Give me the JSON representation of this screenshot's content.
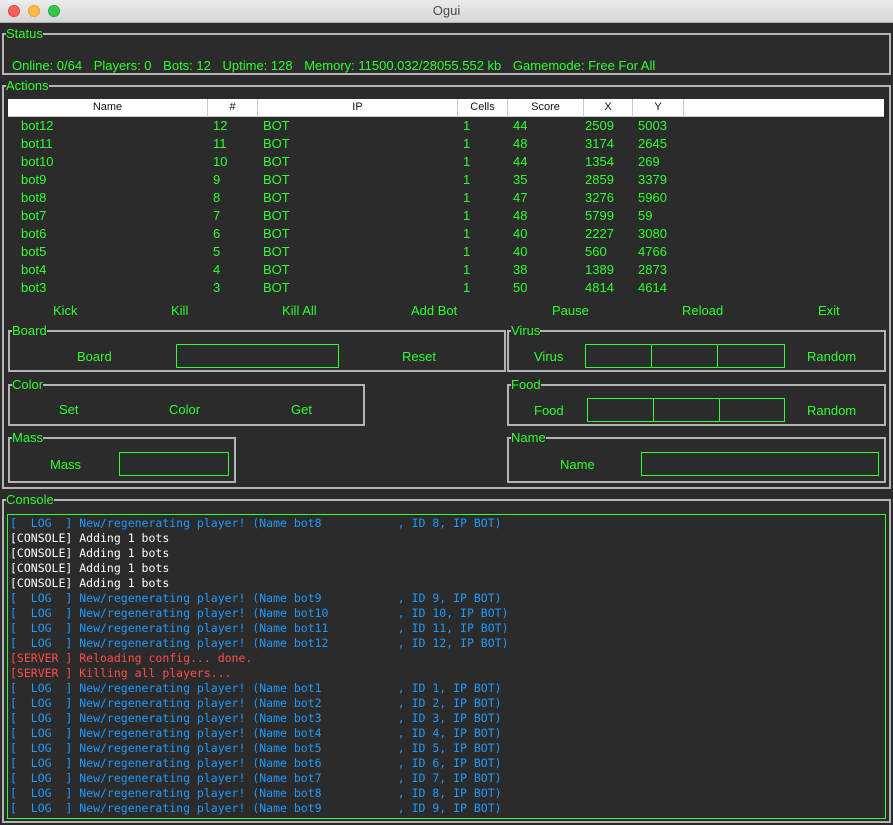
{
  "window": {
    "title": "Ogui"
  },
  "status": {
    "legend": "Status",
    "online": "Online: 0/64",
    "players": "Players: 0",
    "bots": "Bots: 12",
    "uptime": "Uptime: 128",
    "memory": "Memory: 11500.032/28055.552 kb",
    "gamemode": "Gamemode: Free For All"
  },
  "actions": {
    "legend": "Actions",
    "columns": [
      "Name",
      "#",
      "IP",
      "Cells",
      "Score",
      "X",
      "Y"
    ],
    "rows": [
      [
        "bot12",
        "12",
        "BOT",
        "1",
        "44",
        "2509",
        "5003"
      ],
      [
        "bot11",
        "11",
        "BOT",
        "1",
        "48",
        "3174",
        "2645"
      ],
      [
        "bot10",
        "10",
        "BOT",
        "1",
        "44",
        "1354",
        "269"
      ],
      [
        "bot9",
        "9",
        "BOT",
        "1",
        "35",
        "2859",
        "3379"
      ],
      [
        "bot8",
        "8",
        "BOT",
        "1",
        "47",
        "3276",
        "5960"
      ],
      [
        "bot7",
        "7",
        "BOT",
        "1",
        "48",
        "5799",
        "59"
      ],
      [
        "bot6",
        "6",
        "BOT",
        "1",
        "40",
        "2227",
        "3080"
      ],
      [
        "bot5",
        "5",
        "BOT",
        "1",
        "40",
        "560",
        "4766"
      ],
      [
        "bot4",
        "4",
        "BOT",
        "1",
        "38",
        "1389",
        "2873"
      ],
      [
        "bot3",
        "3",
        "BOT",
        "1",
        "50",
        "4814",
        "4614"
      ]
    ],
    "kick": "Kick",
    "kill": "Kill",
    "kill_all": "Kill All",
    "add_bot": "Add Bot",
    "pause": "Pause",
    "reload": "Reload",
    "exit": "Exit"
  },
  "board": {
    "legend": "Board",
    "label": "Board",
    "value": "",
    "reset": "Reset"
  },
  "virus": {
    "legend": "Virus",
    "label": "Virus",
    "v1": "",
    "v2": "",
    "v3": "",
    "random": "Random"
  },
  "color": {
    "legend": "Color",
    "set": "Set",
    "label": "Color",
    "get": "Get"
  },
  "food": {
    "legend": "Food",
    "label": "Food",
    "v1": "",
    "v2": "",
    "v3": "",
    "random": "Random"
  },
  "mass": {
    "legend": "Mass",
    "label": "Mass",
    "value": ""
  },
  "name": {
    "legend": "Name",
    "label": "Name",
    "value": ""
  },
  "console": {
    "legend": "Console",
    "lines": [
      {
        "text": "[  LOG  ] New/regenerating player! (Name bot8           , ID 8, IP BOT)",
        "kind": "log"
      },
      {
        "text": "[CONSOLE] Adding 1 bots",
        "kind": "console"
      },
      {
        "text": "[CONSOLE] Adding 1 bots",
        "kind": "console"
      },
      {
        "text": "[CONSOLE] Adding 1 bots",
        "kind": "console"
      },
      {
        "text": "[CONSOLE] Adding 1 bots",
        "kind": "console"
      },
      {
        "text": "[  LOG  ] New/regenerating player! (Name bot9           , ID 9, IP BOT)",
        "kind": "log"
      },
      {
        "text": "[  LOG  ] New/regenerating player! (Name bot10          , ID 10, IP BOT)",
        "kind": "log"
      },
      {
        "text": "[  LOG  ] New/regenerating player! (Name bot11          , ID 11, IP BOT)",
        "kind": "log"
      },
      {
        "text": "[  LOG  ] New/regenerating player! (Name bot12          , ID 12, IP BOT)",
        "kind": "log"
      },
      {
        "text": "[SERVER ] Reloading config... done.",
        "kind": "server"
      },
      {
        "text": "[SERVER ] Killing all players...",
        "kind": "server"
      },
      {
        "text": "[  LOG  ] New/regenerating player! (Name bot1           , ID 1, IP BOT)",
        "kind": "log"
      },
      {
        "text": "[  LOG  ] New/regenerating player! (Name bot2           , ID 2, IP BOT)",
        "kind": "log"
      },
      {
        "text": "[  LOG  ] New/regenerating player! (Name bot3           , ID 3, IP BOT)",
        "kind": "log"
      },
      {
        "text": "[  LOG  ] New/regenerating player! (Name bot4           , ID 4, IP BOT)",
        "kind": "log"
      },
      {
        "text": "[  LOG  ] New/regenerating player! (Name bot5           , ID 5, IP BOT)",
        "kind": "log"
      },
      {
        "text": "[  LOG  ] New/regenerating player! (Name bot6           , ID 6, IP BOT)",
        "kind": "log"
      },
      {
        "text": "[  LOG  ] New/regenerating player! (Name bot7           , ID 7, IP BOT)",
        "kind": "log"
      },
      {
        "text": "[  LOG  ] New/regenerating player! (Name bot8           , ID 8, IP BOT)",
        "kind": "log"
      },
      {
        "text": "[  LOG  ] New/regenerating player! (Name bot9           , ID 9, IP BOT)",
        "kind": "log"
      }
    ]
  },
  "colors": {
    "accent_green": "#2fff2f",
    "log_blue": "#1e9bff",
    "console_white": "#ffffff",
    "server_red": "#ff4d4d",
    "background": "#2b2b2b"
  }
}
